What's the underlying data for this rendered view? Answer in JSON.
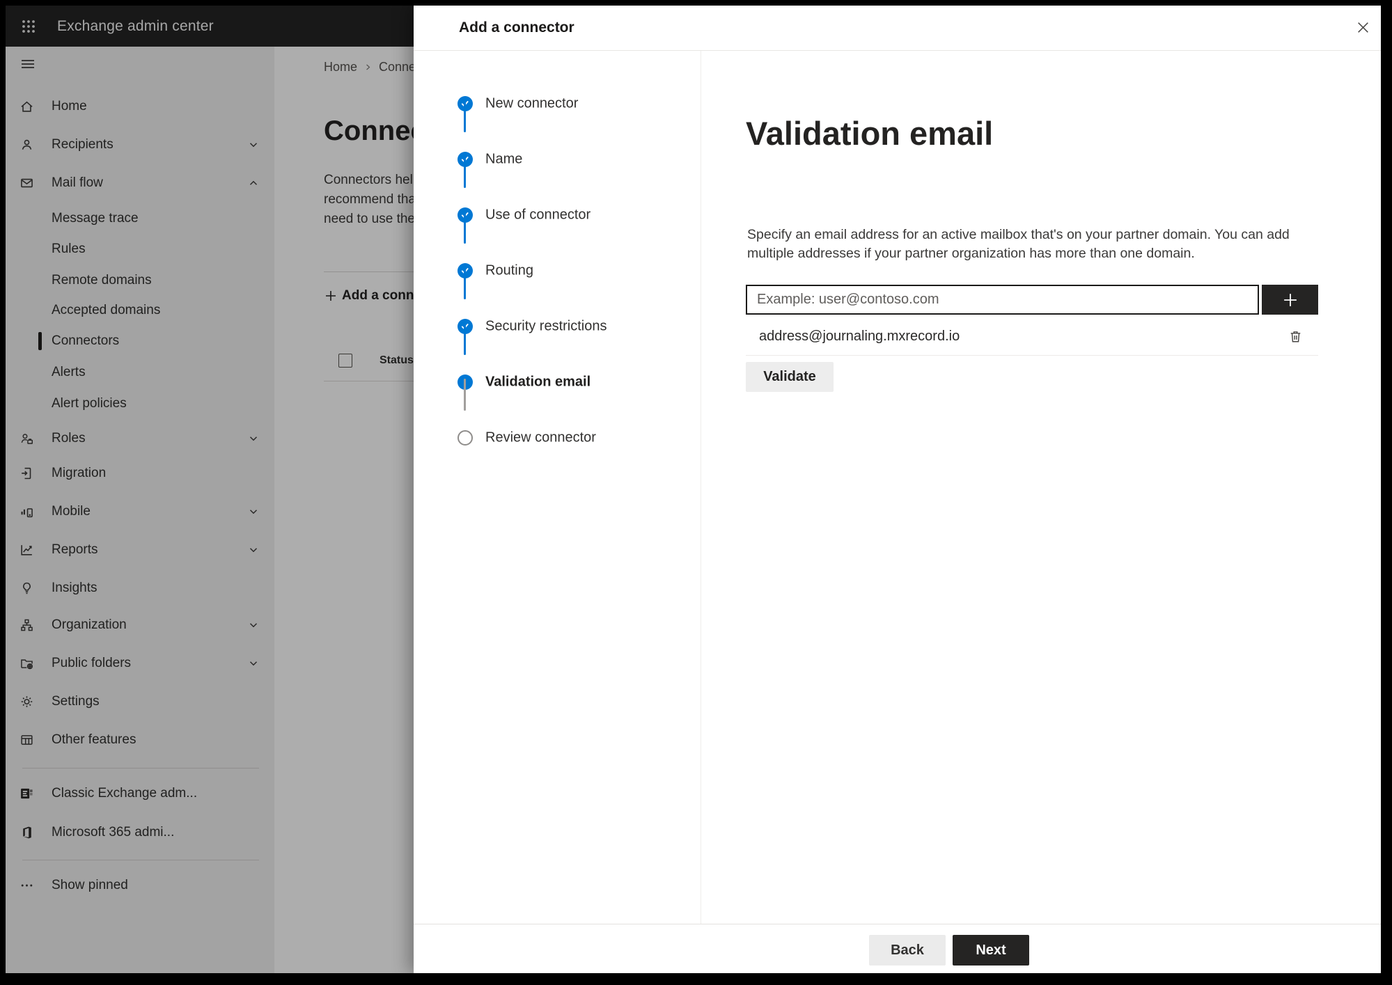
{
  "app": {
    "title": "Exchange admin center"
  },
  "colors": {
    "accent": "#0078d4",
    "topbar": "#242424",
    "dark_button": "#252423",
    "dim_overlay": "rgba(0,0,0,0.32)",
    "selected_marker": "#1f1e1d"
  },
  "icons": {
    "app_launcher": "waffle-grid",
    "menu": "hamburger",
    "plus": "+",
    "ellipsis": "...",
    "close": "x",
    "trash": "trash-can",
    "checkmark": "check"
  },
  "sidebar": {
    "items": [
      {
        "label": "Home",
        "icon": "home"
      },
      {
        "label": "Recipients",
        "icon": "person",
        "chevron": "down"
      },
      {
        "label": "Mail flow",
        "icon": "mail",
        "chevron": "up",
        "expanded": true
      },
      {
        "label": "Message trace",
        "child": true
      },
      {
        "label": "Rules",
        "child": true
      },
      {
        "label": "Remote domains",
        "child": true
      },
      {
        "label": "Accepted domains",
        "child": true
      },
      {
        "label": "Connectors",
        "child": true,
        "selected": true
      },
      {
        "label": "Alerts",
        "child": true
      },
      {
        "label": "Alert policies",
        "child": true
      },
      {
        "label": "Roles",
        "icon": "roles",
        "chevron": "down"
      },
      {
        "label": "Migration",
        "icon": "migration"
      },
      {
        "label": "Mobile",
        "icon": "mobile",
        "chevron": "down"
      },
      {
        "label": "Reports",
        "icon": "reports",
        "chevron": "down"
      },
      {
        "label": "Insights",
        "icon": "insights"
      },
      {
        "label": "Organization",
        "icon": "organization",
        "chevron": "down"
      },
      {
        "label": "Public folders",
        "icon": "public-folders",
        "chevron": "down"
      },
      {
        "label": "Settings",
        "icon": "settings"
      },
      {
        "label": "Other features",
        "icon": "other-features"
      }
    ],
    "footer_items": [
      {
        "label": "Classic Exchange adm...",
        "icon": "classic-exchange"
      },
      {
        "label": "Microsoft 365 admi...",
        "icon": "microsoft-365"
      }
    ],
    "show_pinned": "Show pinned"
  },
  "page": {
    "breadcrumb": {
      "home": "Home",
      "current": "Conne"
    },
    "title": "Connect",
    "intro_lines": [
      "Connectors help",
      "recommend that",
      "need to use ther"
    ],
    "add_button": "Add a conn",
    "status_header": "Status"
  },
  "dialog": {
    "title": "Add a connector",
    "steps": [
      {
        "label": "New connector",
        "state": "complete"
      },
      {
        "label": "Name",
        "state": "complete"
      },
      {
        "label": "Use of connector",
        "state": "complete"
      },
      {
        "label": "Routing",
        "state": "complete"
      },
      {
        "label": "Security restrictions",
        "state": "complete"
      },
      {
        "label": "Validation email",
        "state": "active"
      },
      {
        "label": "Review connector",
        "state": "upcoming"
      }
    ],
    "content": {
      "heading": "Validation email",
      "description_lines": [
        "Specify an email address for an active mailbox that's on your partner domain. You can add",
        "multiple addresses if your partner organization has more than one domain."
      ],
      "email_input": {
        "value": "",
        "placeholder": "Example: user@contoso.com"
      },
      "addresses": [
        "address@journaling.mxrecord.io"
      ],
      "validate_button": "Validate"
    },
    "footer": {
      "back": "Back",
      "next": "Next"
    }
  }
}
